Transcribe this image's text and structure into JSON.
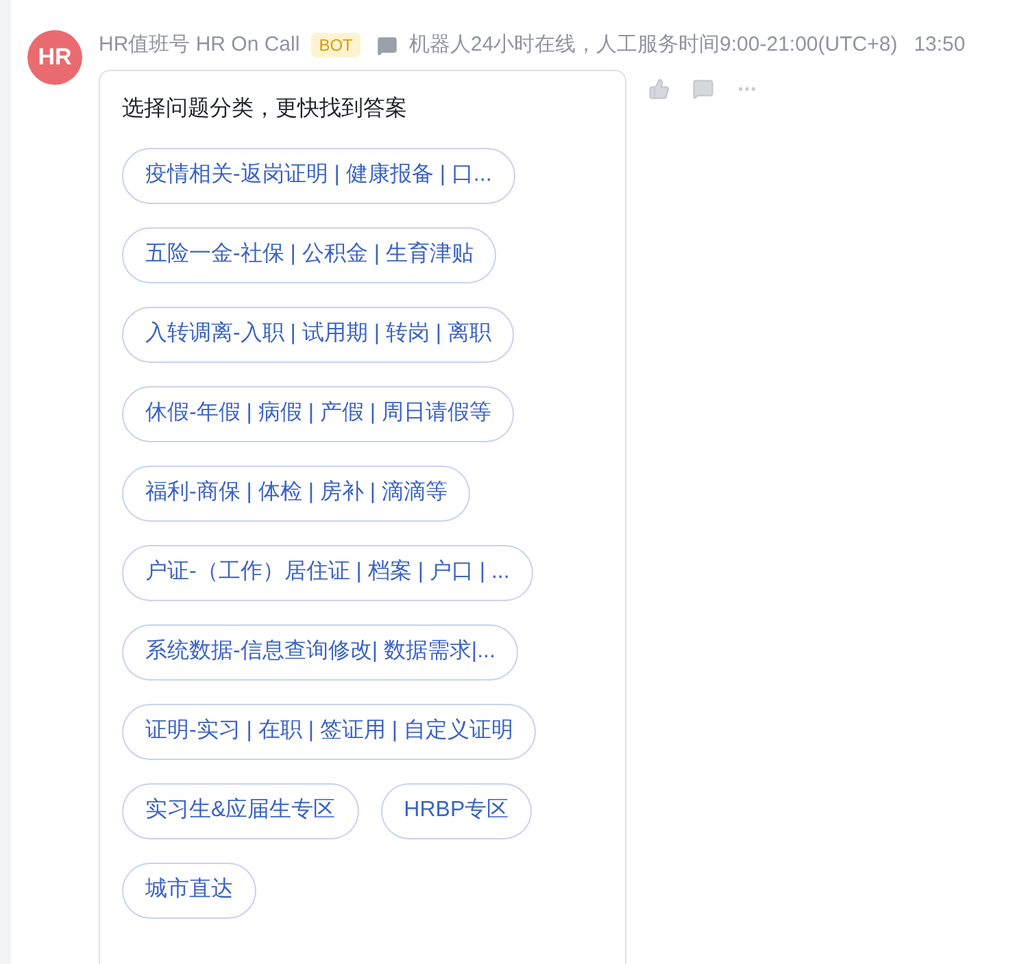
{
  "message": {
    "avatar": "HR",
    "sender": "HR值班号 HR On Call",
    "badge": "BOT",
    "status": "机器人24小时在线，人工服务时间9:00-21:00(UTC+8)",
    "time": "13:50"
  },
  "card": {
    "title": "选择问题分类，更快找到答案",
    "options": [
      {
        "label": "疫情相关-返岗证明 | 健康报备 | 口..."
      },
      {
        "label": "五险一金-社保 | 公积金 | 生育津贴"
      },
      {
        "label": "入转调离-入职 | 试用期 | 转岗 | 离职"
      },
      {
        "label": "休假-年假 | 病假 | 产假 | 周日请假等"
      },
      {
        "label": "福利-商保 | 体检 | 房补 | 滴滴等"
      },
      {
        "label": "户证-（工作）居住证 | 档案 | 户口 | ..."
      },
      {
        "label": "系统数据-信息查询修改| 数据需求|..."
      },
      {
        "label": "证明-实习 | 在职 | 签证用 | 自定义证明"
      },
      {
        "label": "实习生&应届生专区"
      },
      {
        "label": "HRBP专区"
      },
      {
        "label": "城市直达"
      }
    ]
  }
}
